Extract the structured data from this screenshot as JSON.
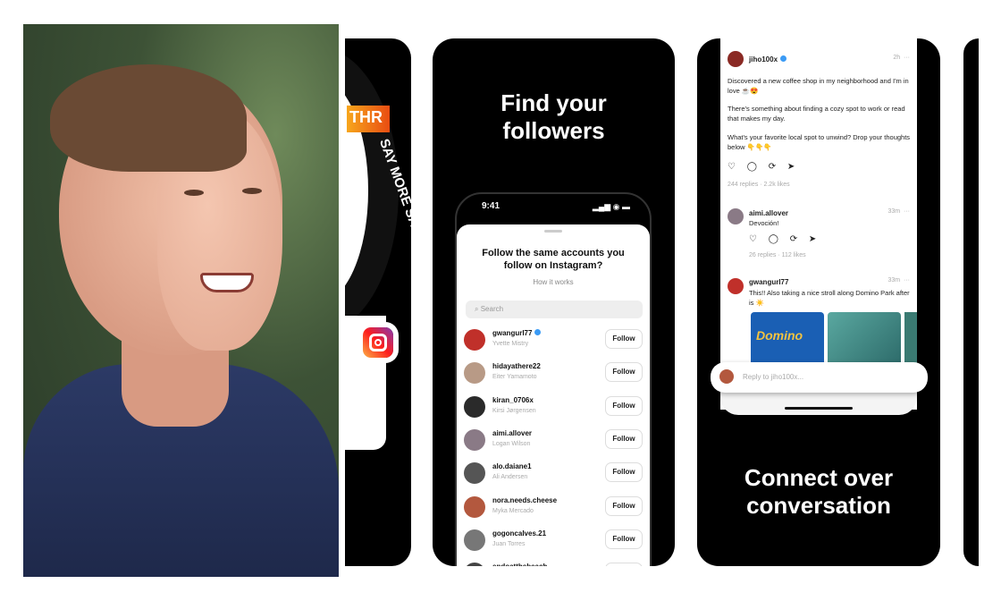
{
  "photo": {
    "subject": "person-portrait"
  },
  "panel1": {
    "ring_text": "SAY MORE SAY MORE",
    "badge": "THR",
    "icon": "instagram-icon"
  },
  "panel2": {
    "title_line1": "Find your",
    "title_line2": "followers",
    "status_time": "9:41",
    "status_icons": "▂▄▆ ◉ ▬",
    "sheet_title_line1": "Follow the same accounts you",
    "sheet_title_line2": "follow on Instagram?",
    "how_it_works": "How it works",
    "search_placeholder": "Search",
    "follow_label": "Follow",
    "accounts": [
      {
        "username": "gwangurl77",
        "name": "Yvette Mistry",
        "verified": true,
        "color": "#c0302a"
      },
      {
        "username": "hidayathere22",
        "name": "Eiter Yamamoto",
        "verified": false,
        "color": "#b89a86"
      },
      {
        "username": "kiran_0706x",
        "name": "Kirsi Jørgensen",
        "verified": false,
        "color": "#2a2a2a"
      },
      {
        "username": "aimi.allover",
        "name": "Logan Wilson",
        "verified": false,
        "color": "#8a7a86"
      },
      {
        "username": "alo.daiane1",
        "name": "Ali Andersen",
        "verified": false,
        "color": "#555"
      },
      {
        "username": "nora.needs.cheese",
        "name": "Myka Mercado",
        "verified": false,
        "color": "#b3583e"
      },
      {
        "username": "gogoncalves.21",
        "name": "Juan Torres",
        "verified": false,
        "color": "#777"
      },
      {
        "username": "endoatthebeach",
        "name": "",
        "verified": false,
        "color": "#444"
      }
    ]
  },
  "panel3": {
    "title_line1": "Connect over",
    "title_line2": "conversation",
    "post": {
      "username": "jiho100x",
      "time": "2h",
      "p1": "Discovered a new coffee shop in my neighborhood and I'm in love ☕😍",
      "p2": "There's something about finding a cozy spot to work or read that makes my day.",
      "p3": "What's your favorite local spot to unwind? Drop your thoughts below 👇👇👇",
      "actions": "♡ ◯ ⟳ ➤",
      "stats": "244 replies · 2.2k likes"
    },
    "reply1": {
      "username": "aimi.allover",
      "time": "33m",
      "text": "Devoción!",
      "actions": "♡ ◯ ⟳ ➤",
      "stats": "26 replies · 112 likes"
    },
    "reply2": {
      "username": "gwangurl77",
      "time": "33m",
      "text": "This!! Also taking a nice stroll along Domino Park after is ☀️",
      "image_text": "Domino"
    },
    "reply_placeholder": "Reply to jiho100x..."
  }
}
